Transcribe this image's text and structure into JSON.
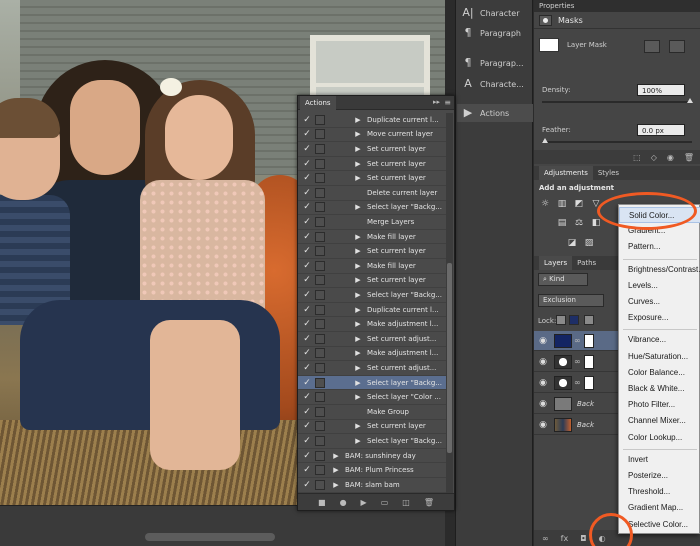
{
  "panels": {
    "dock": [
      {
        "label": "Character",
        "icon": "character-icon",
        "glyph": "A|"
      },
      {
        "label": "Paragraph",
        "icon": "paragraph-icon",
        "glyph": "¶"
      },
      {
        "label": "Paragrap...",
        "icon": "paragraph-styles-icon",
        "glyph": "¶"
      },
      {
        "label": "Characte...",
        "icon": "character-styles-icon",
        "glyph": "A"
      },
      {
        "label": "Actions",
        "icon": "play-icon",
        "glyph": "▶"
      }
    ],
    "properties": {
      "title": "Properties",
      "masks": "Masks",
      "layer_mask": "Layer Mask",
      "density_label": "Density:",
      "density_value": "100%",
      "feather_label": "Feather:",
      "feather_value": "0.0 px"
    },
    "adjustments": {
      "tabs": [
        "Adjustments",
        "Styles"
      ],
      "add_label": "Add an adjustment"
    },
    "layers": {
      "tabs": [
        "Layers",
        "Paths"
      ],
      "kind": "Kind",
      "blend": "Exclusion",
      "lock_label": "Lock:",
      "rows": [
        {
          "name": ""
        },
        {
          "name": ""
        },
        {
          "name": ""
        },
        {
          "name": "Back"
        },
        {
          "name": "Back"
        }
      ]
    }
  },
  "actions": {
    "title": "Actions",
    "header_controls": "▸▸ | ≡",
    "items": [
      {
        "label": "Duplicate current l...",
        "checked": true,
        "expand": true
      },
      {
        "label": "Move current layer",
        "checked": true,
        "expand": true
      },
      {
        "label": "Set current layer",
        "checked": true,
        "expand": true
      },
      {
        "label": "Set current layer",
        "checked": true,
        "expand": true
      },
      {
        "label": "Set current layer",
        "checked": true,
        "expand": true
      },
      {
        "label": "Delete current layer",
        "checked": true,
        "expand": false
      },
      {
        "label": "Select layer \"Backg...",
        "checked": true,
        "expand": true
      },
      {
        "label": "Merge Layers",
        "checked": true,
        "expand": false
      },
      {
        "label": "Make fill layer",
        "checked": true,
        "expand": true
      },
      {
        "label": "Set current layer",
        "checked": true,
        "expand": true
      },
      {
        "label": "Make fill layer",
        "checked": true,
        "expand": true
      },
      {
        "label": "Set current layer",
        "checked": true,
        "expand": true
      },
      {
        "label": "Select layer \"Backg...",
        "checked": true,
        "expand": true
      },
      {
        "label": "Duplicate current l...",
        "checked": true,
        "expand": true
      },
      {
        "label": "Make adjustment l...",
        "checked": true,
        "expand": true
      },
      {
        "label": "Set current adjust...",
        "checked": true,
        "expand": true
      },
      {
        "label": "Make adjustment l...",
        "checked": true,
        "expand": true
      },
      {
        "label": "Set current adjust...",
        "checked": true,
        "expand": true
      },
      {
        "label": "Select layer \"Backg...",
        "checked": true,
        "expand": true,
        "selected": true
      },
      {
        "label": "Select layer \"Color ...",
        "checked": true,
        "expand": true
      },
      {
        "label": "Make Group",
        "checked": true,
        "expand": false
      },
      {
        "label": "Set current layer",
        "checked": true,
        "expand": true
      },
      {
        "label": "Select layer \"Backg...",
        "checked": true,
        "expand": true
      },
      {
        "label": "BAM: sunshiney day",
        "checked": true,
        "expand": true,
        "set": true
      },
      {
        "label": "BAM: Plum Princess",
        "checked": true,
        "expand": true,
        "set": true
      },
      {
        "label": "BAM: slam bam",
        "checked": true,
        "expand": true,
        "set": true
      }
    ]
  },
  "context_menu": {
    "items": [
      {
        "label": "Solid Color...",
        "highlight": true
      },
      {
        "label": "Gradient..."
      },
      {
        "label": "Pattern..."
      },
      {
        "sep": true
      },
      {
        "label": "Brightness/Contrast..."
      },
      {
        "label": "Levels..."
      },
      {
        "label": "Curves..."
      },
      {
        "label": "Exposure..."
      },
      {
        "sep": true
      },
      {
        "label": "Vibrance..."
      },
      {
        "label": "Hue/Saturation..."
      },
      {
        "label": "Color Balance..."
      },
      {
        "label": "Black & White..."
      },
      {
        "label": "Photo Filter..."
      },
      {
        "label": "Channel Mixer..."
      },
      {
        "label": "Color Lookup..."
      },
      {
        "sep": true
      },
      {
        "label": "Invert"
      },
      {
        "label": "Posterize..."
      },
      {
        "label": "Threshold..."
      },
      {
        "label": "Gradient Map..."
      },
      {
        "label": "Selective Color..."
      }
    ]
  },
  "colors": {
    "annotation": "#f05a23",
    "selection": "#5b6e8f",
    "menu_bg": "#f0f0f0"
  }
}
